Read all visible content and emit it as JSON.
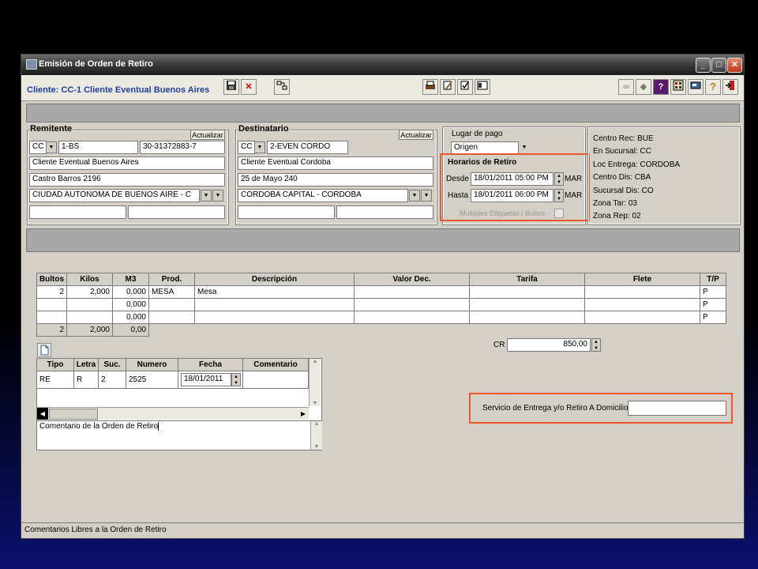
{
  "window": {
    "title": "Emisión de Orden de Retiro",
    "minimize": "_",
    "maximize": "□",
    "close": "✕"
  },
  "toolbar": {
    "client_label": "Cliente: CC-1 Cliente Eventual Buenos Aires",
    "icons": [
      "save-icon",
      "cancel-icon",
      "tree-icon",
      "print-icon",
      "edit-icon",
      "edit-check-icon",
      "form-icon",
      "binoculars-icon",
      "arrow-icon",
      "question-box-icon",
      "calculator-icon",
      "card-icon",
      "help-icon",
      "exit-icon"
    ]
  },
  "remitente": {
    "title": "Remitente",
    "actualizar": "Actualizar",
    "tipo": "CC",
    "codigo": "1-BS",
    "cuit": "30-31372883-7",
    "nombre": "Cliente Eventual Buenos Aires",
    "direccion": "Castro Barros 2196",
    "localidad": "CIUDAD AUTONOMA DE BUENOS AIRE - C",
    "extra1": "",
    "extra2": ""
  },
  "destinatario": {
    "title": "Destinatario",
    "actualizar": "Actualizar",
    "tipo": "CC",
    "codigo": "2-EVEN CORDO",
    "nombre": "Cliente Eventual Cordoba",
    "direccion": "25 de Mayo 240",
    "localidad": "CORDOBA CAPITAL - CORDOBA",
    "extra1": "",
    "extra2": ""
  },
  "pago": {
    "label": "Lugar de pago",
    "value": "Origen",
    "horarios_title": "Horarios de Retiro",
    "desde_label": "Desde",
    "desde_value": "18/01/2011 05:00 PM",
    "desde_day": "MAR",
    "hasta_label": "Hasta",
    "hasta_value": "18/01/2011 06:00 PM",
    "hasta_day": "MAR",
    "multiples_label": "Multiples Etiquetas / Bultos"
  },
  "info": {
    "centro_rec": "Centro Rec: BUE",
    "en_sucursal": "En Sucursal: CC",
    "loc_entrega": "Loc Entrega: CORDOBA",
    "centro_dis": "Centro Dis: CBA",
    "sucursal_dis": "Sucursal Dis: CO",
    "zona_tar": "Zona Tar: 03",
    "zona_rep": "Zona Rep: 02"
  },
  "items": {
    "headers": [
      "Bultos",
      "Kilos",
      "M3",
      "Prod.",
      "Descripción",
      "Valor Dec.",
      "Tarifa",
      "Flete",
      "T/P"
    ],
    "rows": [
      [
        "2",
        "2,000",
        "0,000",
        "MESA",
        "Mesa",
        "",
        "",
        "",
        "P"
      ],
      [
        "",
        "",
        "0,000",
        "",
        "",
        "",
        "",
        "",
        "P"
      ],
      [
        "",
        "",
        "0,000",
        "",
        "",
        "",
        "",
        "",
        "P"
      ]
    ],
    "totals": [
      "2",
      "2,000",
      "0,00"
    ]
  },
  "cr": {
    "label": "CR",
    "value": "850,00"
  },
  "comprobantes": {
    "headers": [
      "Tipo",
      "Letra",
      "Suc.",
      "Numero",
      "Fecha",
      "Comentario"
    ],
    "row": [
      "RE",
      "R",
      "2",
      "2525",
      "18/01/2011",
      ""
    ]
  },
  "comentario": "Comentario de la Orden de Retiro",
  "servicio": {
    "label": "Servicio de Entrega y/o Retiro A Domicilio",
    "value": ""
  },
  "status": "Comentarios Libres a la Orden de Retiro",
  "colors": {
    "highlight": "#e8582c",
    "client_text": "#1e3fa0"
  }
}
